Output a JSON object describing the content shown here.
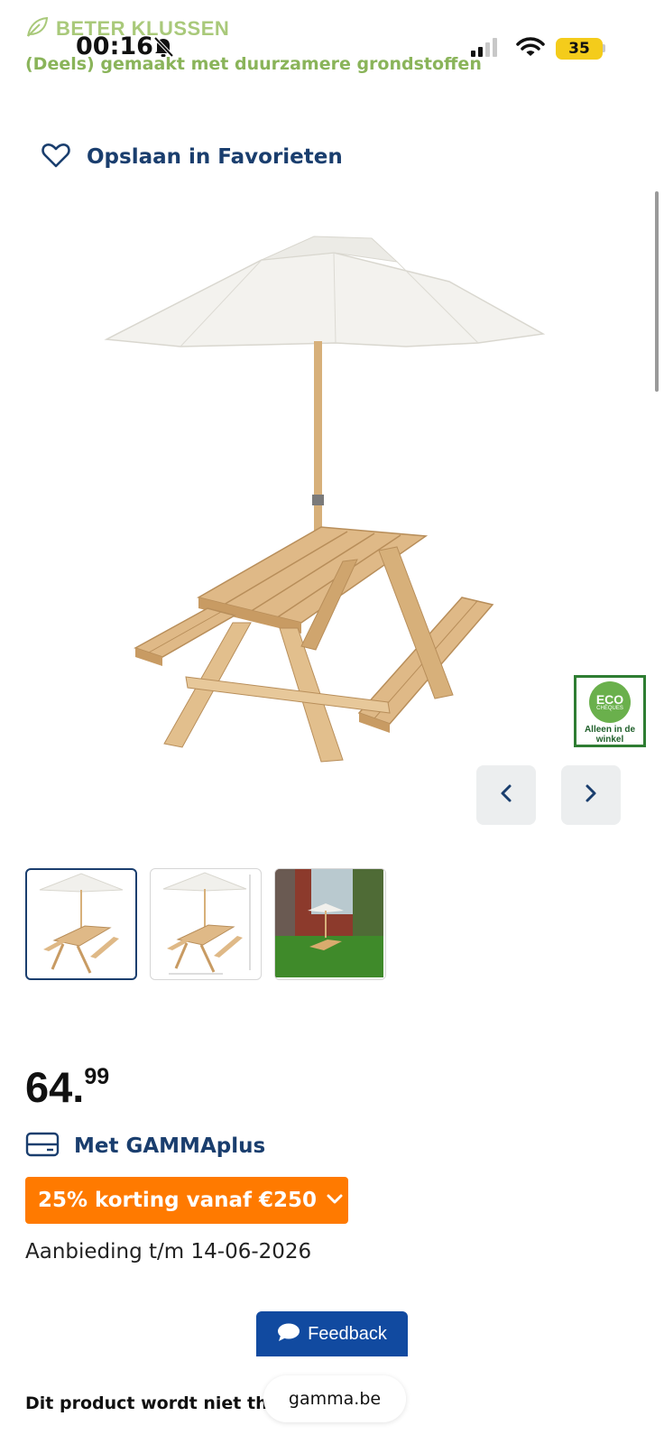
{
  "status_bar": {
    "time": "00:16",
    "battery": "35",
    "icons": [
      "bell-slash-icon",
      "signal-icon",
      "wifi-icon",
      "battery-icon"
    ]
  },
  "sustainability": {
    "brand": "BETER KLUSSEN",
    "note": "(Deels) gemaakt met duurzamere grondstoffen",
    "icon": "leaf-icon",
    "color": "#8ab45a"
  },
  "favorites": {
    "label": "Opslaan in Favorieten",
    "icon": "heart-icon"
  },
  "eco_badge": {
    "title": "ECO",
    "subtitle": "CHÈQUES",
    "note": "Alleen in de winkel"
  },
  "gallery": {
    "prev_icon": "chevron-left-icon",
    "next_icon": "chevron-right-icon",
    "thumbnails": [
      "picnic-table-umbrella",
      "picnic-table-dimensions",
      "picnic-table-garden"
    ],
    "active_index": 0
  },
  "price": {
    "integer": "64.",
    "decimal": "99"
  },
  "gammaplus": {
    "label": "Met GAMMAplus",
    "icon": "card-icon"
  },
  "promo": {
    "label": "25% korting vanaf €250",
    "icon": "chevron-down-icon",
    "color": "#ff7a00"
  },
  "offer_text": "Aanbieding t/m 14-06-2026",
  "feedback": {
    "label": "Feedback",
    "icon": "chat-bubble-icon",
    "color": "#114aa0"
  },
  "footer_text": "Dit product wordt niet th",
  "browser_url": "gamma.be",
  "colors": {
    "brand_blue": "#1a3e6e",
    "price_text": "#111111"
  }
}
